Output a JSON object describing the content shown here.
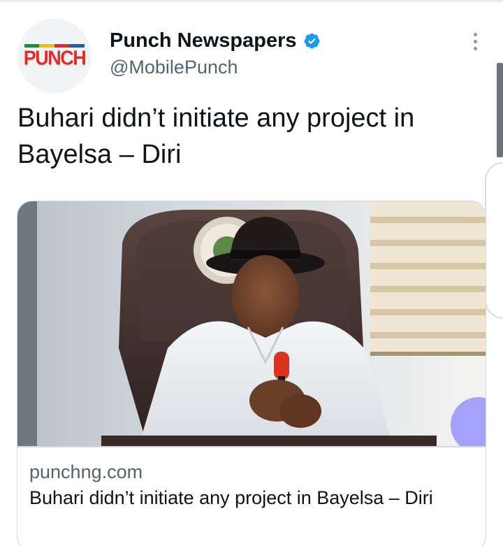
{
  "account": {
    "name": "Punch Newspapers",
    "handle": "@MobilePunch",
    "avatar_logo_text": "PUNCH",
    "verified": true
  },
  "tweet": {
    "text": "Buhari didn’t initiate any project in Bayelsa – Diri"
  },
  "link_card": {
    "domain": "punchng.com",
    "title": "Buhari didn’t initiate any project in Bayelsa – Diri"
  },
  "icons": {
    "verified": "verified-badge-icon",
    "more": "more-options-icon"
  },
  "colors": {
    "brand_red": "#e42b27",
    "verified_blue": "#1d9bf0",
    "secondary_text": "#536471",
    "border": "#cfd9de"
  }
}
